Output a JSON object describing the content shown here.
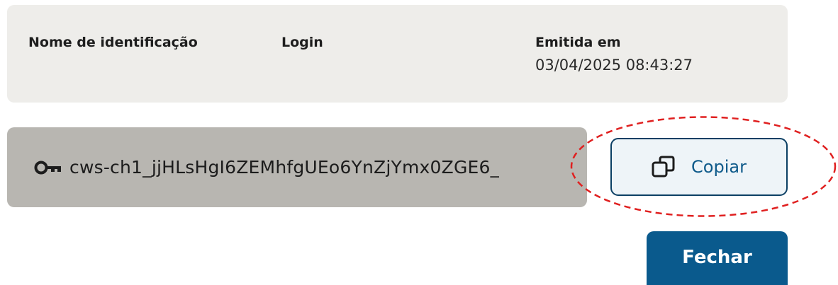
{
  "info": {
    "name_label": "Nome de identificação",
    "login_label": "Login",
    "issued_label": "Emitida em",
    "issued_value": "03/04/2025 08:43:27"
  },
  "token": {
    "value": "cws-ch1_jjHLsHgI6ZEMhfgUEo6YnZjYmx0ZGE6_",
    "icon": "key-icon"
  },
  "actions": {
    "copy_label": "Copiar",
    "copy_icon": "copy-icon",
    "close_label": "Fechar"
  },
  "colors": {
    "primary": "#0a5a8d",
    "highlight": "#e02020"
  }
}
